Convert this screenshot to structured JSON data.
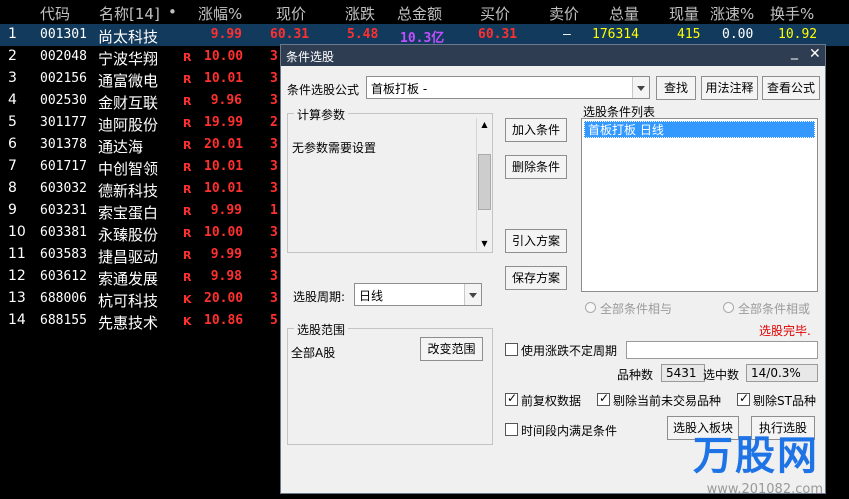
{
  "table": {
    "headers": [
      "代码",
      "名称[14]",
      "•",
      "涨幅%",
      "现价",
      "涨跌",
      "总金额",
      "买价",
      "卖价",
      "总量",
      "现量",
      "涨速%",
      "换手%"
    ],
    "row1": {
      "idx": "1",
      "code": "001301",
      "name": "尚太科技",
      "chg": "9.99",
      "price": "60.31",
      "change": "5.48",
      "amount": "10.3亿",
      "bid": "60.31",
      "ask": "—",
      "volume": "176314",
      "cur_vol": "415",
      "speed": "0.00",
      "turnover": "10.92"
    },
    "rows": [
      {
        "idx": "2",
        "code": "002048",
        "name": "宁波华翔",
        "flag": "R",
        "chg": "10.00"
      },
      {
        "idx": "3",
        "code": "002156",
        "name": "通富微电",
        "flag": "R",
        "chg": "10.01"
      },
      {
        "idx": "4",
        "code": "002530",
        "name": "金财互联",
        "flag": "R",
        "chg": "9.96"
      },
      {
        "idx": "5",
        "code": "301177",
        "name": "迪阿股份",
        "flag": "R",
        "chg": "19.99"
      },
      {
        "idx": "6",
        "code": "301378",
        "name": "通达海",
        "flag": "R",
        "chg": "20.01"
      },
      {
        "idx": "7",
        "code": "601717",
        "name": "中创智领",
        "flag": "R",
        "chg": "10.01"
      },
      {
        "idx": "8",
        "code": "603032",
        "name": "德新科技",
        "flag": "R",
        "chg": "10.01"
      },
      {
        "idx": "9",
        "code": "603231",
        "name": "索宝蛋白",
        "flag": "R",
        "chg": "9.99"
      },
      {
        "idx": "10",
        "code": "603381",
        "name": "永臻股份",
        "flag": "R",
        "chg": "10.00"
      },
      {
        "idx": "11",
        "code": "603583",
        "name": "捷昌驱动",
        "flag": "R",
        "chg": "9.99"
      },
      {
        "idx": "12",
        "code": "603612",
        "name": "索通发展",
        "flag": "R",
        "chg": "9.98"
      },
      {
        "idx": "13",
        "code": "688006",
        "name": "杭可科技",
        "flag": "K",
        "chg": "20.00"
      },
      {
        "idx": "14",
        "code": "688155",
        "name": "先惠技术",
        "flag": "K",
        "chg": "10.86"
      }
    ],
    "price_col_partial": [
      "3",
      "3",
      "3",
      "2",
      "3",
      "3",
      "3",
      "1",
      "3",
      "3",
      "3",
      "3",
      "5"
    ]
  },
  "dialog": {
    "title": "条件选股",
    "formula_label": "条件选股公式",
    "formula_value": "首板打板  -",
    "btn_find": "查找",
    "btn_usage": "用法注释",
    "btn_view": "查看公式",
    "calc_group": "计算参数",
    "no_params": "无参数需要设置",
    "btn_add": "加入条件",
    "btn_delete": "删除条件",
    "btn_import": "引入方案",
    "btn_save": "保存方案",
    "cond_list_label": "选股条件列表",
    "cond_item": "首板打板  日线",
    "period_label": "选股周期:",
    "period_value": "日线",
    "radio_all_and": "全部条件相与",
    "radio_all_or": "全部条件相或",
    "status": "选股完毕.",
    "range_group": "选股范围",
    "range_value": "全部A股",
    "btn_change_range": "改变范围",
    "use_uncertain": "使用涨跌不定周期",
    "count_label": "品种数",
    "count_value": "5431",
    "selected_label": "选中数",
    "selected_value": "14/0.3%",
    "fq_label": "前复权数据",
    "exclude_untraded": "剔除当前未交易品种",
    "exclude_st": "剔除ST品种",
    "time_range": "时间段内满足条件",
    "btn_to_block": "选股入板块",
    "btn_execute": "执行选股",
    "btn_close_partial": "关闭"
  },
  "watermark": {
    "logo": "万股网",
    "url": "www.201082.com"
  },
  "colors": {
    "up": "#ff3030",
    "header": "#c0c0c0",
    "amount": "#c050ff",
    "volume": "#ffff00",
    "title_bar": "#2f3d52",
    "selection": "#3399ff"
  }
}
